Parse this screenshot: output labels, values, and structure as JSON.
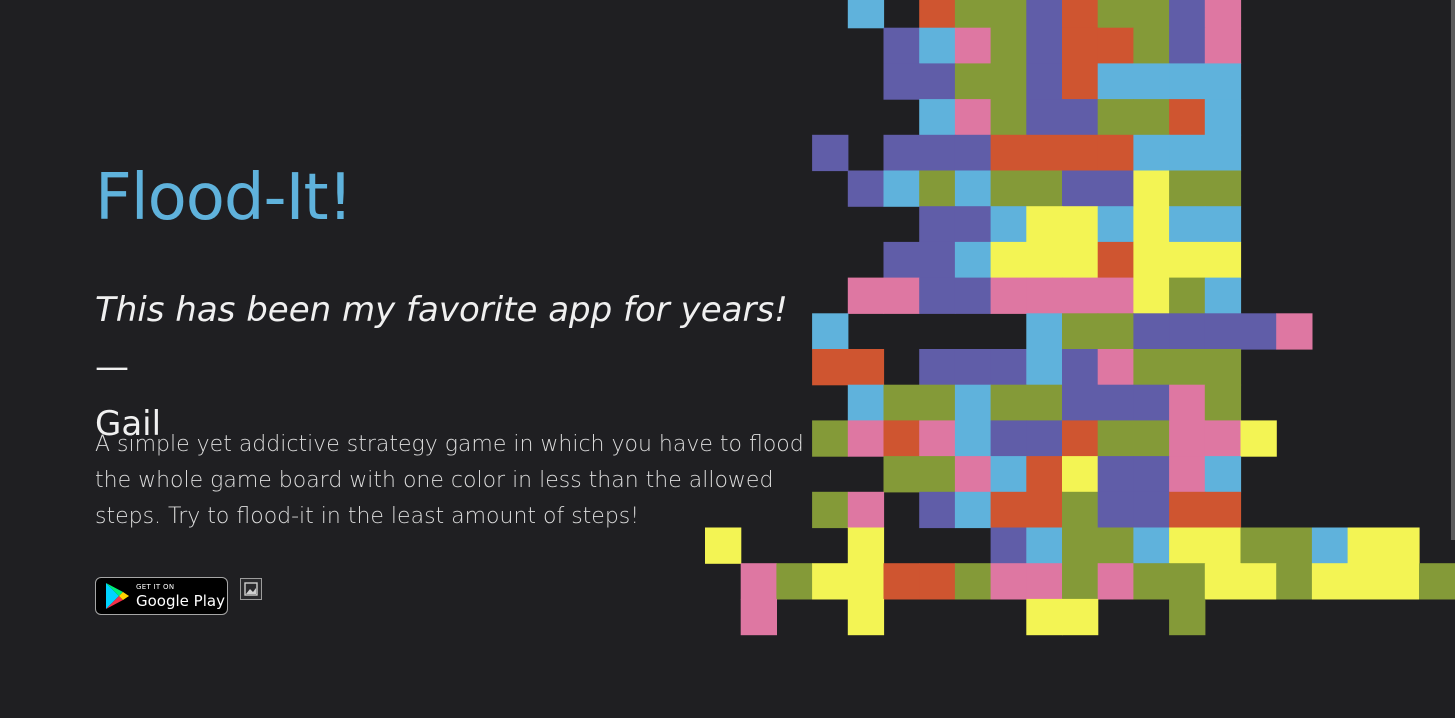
{
  "title": "Flood-It!",
  "quote": {
    "text": "This has been my favorite app for years!",
    "dash": " — ",
    "author": "Gail"
  },
  "description": "A simple yet addictive strategy game in which you have to flood the whole game board with one color in less than the allowed steps. Try to flood-it in the least amount of steps!",
  "store_badge": {
    "small": "GET IT ON",
    "big": "Google Play"
  },
  "palette": {
    "B": "#5fb2dc",
    "O": "#cf5530",
    "G": "#849a38",
    "P": "#605da8",
    "K": "#de77a2",
    "Y": "#f3f454"
  },
  "board": {
    "cols": 21,
    "cell": 35.7,
    "rows": [
      "....B.OGGPOGGPK",
      ".....PBKGPOOGPK",
      ".....PPGGPOBBBB",
      "......BKGPPGGOB",
      "...P.PPPOOOOBBB",
      "....PBGBGGPPYGG",
      "......PPBYYBYBB",
      ".....PPBYYYOYYY",
      "....KKPPKKKKYGB",
      "...B.....BGGPPPPK",
      "...OO.PPPBPKGGG",
      "....BGGBGGPPPKG",
      "...GKOKBPPOGGKKY",
      ".....GGKBOYPPKB",
      "...GK.PBOOGPPOO",
      "Y...Y...PBGGBYYGGBYY",
      ".KGYYOOGKKGKGGYYGYYYG",
      ".K..Y....YY..G"
    ]
  }
}
